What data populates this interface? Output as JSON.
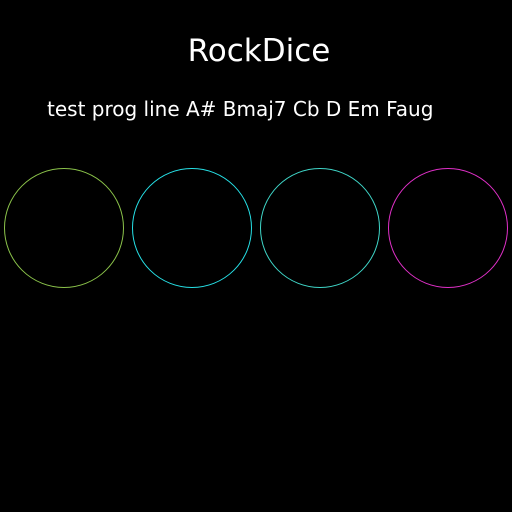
{
  "app": {
    "title": "RockDice"
  },
  "progression": {
    "text": "test prog line A# Bmaj7 Cb D Em Faug"
  },
  "dice": [
    {
      "color": "#8bc34a"
    },
    {
      "color": "#26e0e6"
    },
    {
      "color": "#3fd6c8"
    },
    {
      "color": "#e030c8"
    }
  ],
  "theme": {
    "background": "#000000",
    "text": "#ffffff"
  }
}
